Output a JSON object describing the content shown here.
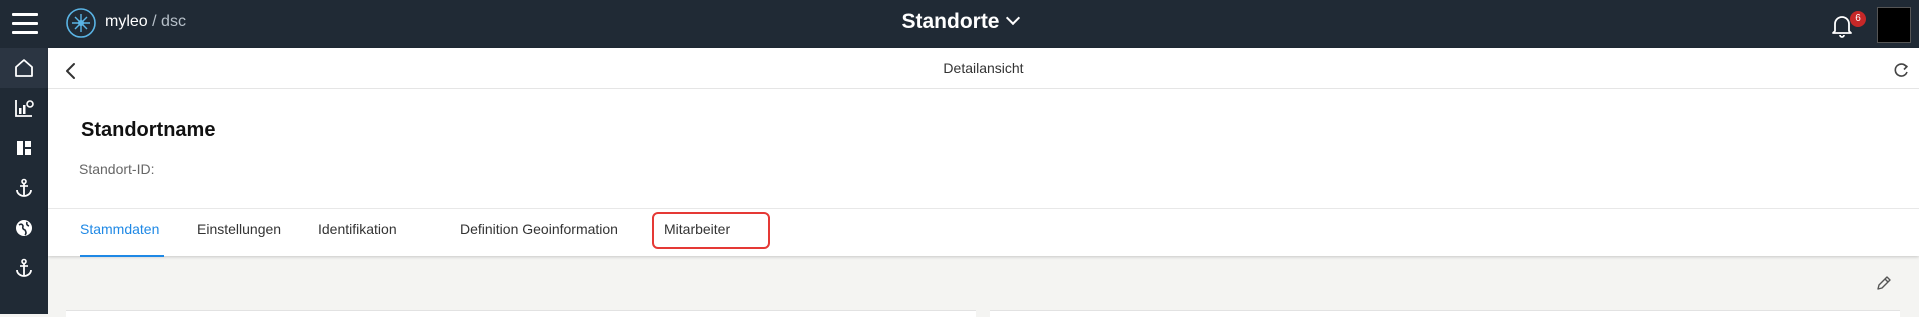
{
  "header": {
    "brand_name": "myleo",
    "brand_separator": "/",
    "brand_sub": "dsc",
    "title": "Standorte",
    "notification_count": "6"
  },
  "sidebar": {
    "items": [
      {
        "icon": "home-icon",
        "active": true
      },
      {
        "icon": "chart-settings-icon",
        "active": false
      },
      {
        "icon": "dashboard-icon",
        "active": false
      },
      {
        "icon": "anchor-icon",
        "active": false
      },
      {
        "icon": "globe-icon",
        "active": false
      },
      {
        "icon": "anchor-icon",
        "active": false
      }
    ]
  },
  "detail": {
    "title": "Detailansicht",
    "location_name": "Standortname",
    "location_id_label": "Standort-ID:"
  },
  "tabs": [
    {
      "label": "Stammdaten",
      "active": true
    },
    {
      "label": "Einstellungen",
      "active": false
    },
    {
      "label": "Identifikation",
      "active": false
    },
    {
      "label": "Definition Geoinformation",
      "active": false
    },
    {
      "label": "Mitarbeiter",
      "active": false,
      "highlighted": true
    }
  ],
  "colors": {
    "topbar": "#202a35",
    "accent": "#1e88e5",
    "highlight": "#e53935",
    "badge": "#c62828"
  }
}
